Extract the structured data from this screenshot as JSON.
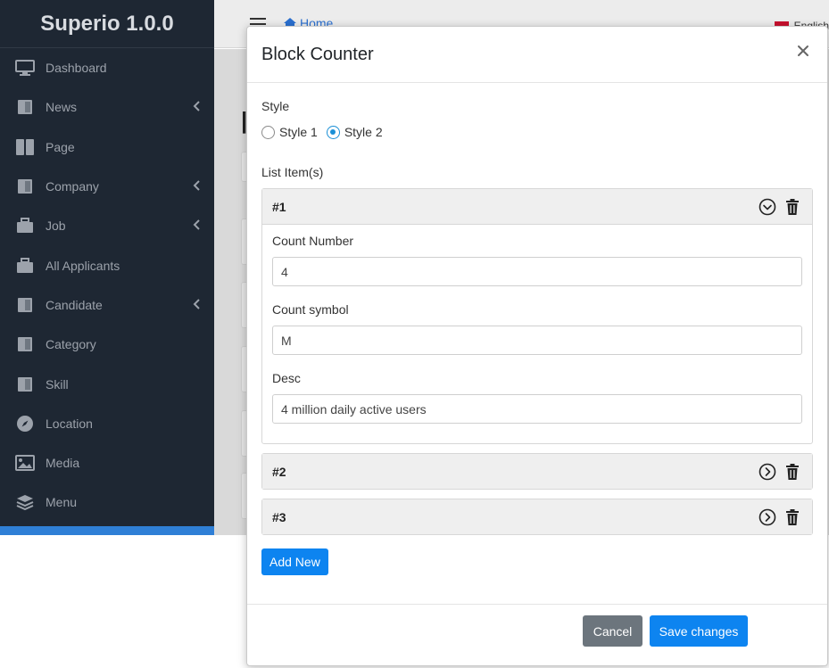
{
  "app": {
    "title": "Superio 1.0.0"
  },
  "sidebar": {
    "items": [
      {
        "label": "Dashboard",
        "icon": "monitor-icon",
        "has_caret": false
      },
      {
        "label": "News",
        "icon": "book-icon",
        "has_caret": true
      },
      {
        "label": "Page",
        "icon": "pages-icon",
        "has_caret": false
      },
      {
        "label": "Company",
        "icon": "book-icon",
        "has_caret": true
      },
      {
        "label": "Job",
        "icon": "briefcase-icon",
        "has_caret": true
      },
      {
        "label": "All Applicants",
        "icon": "briefcase-icon",
        "has_caret": false
      },
      {
        "label": "Candidate",
        "icon": "book-icon",
        "has_caret": true
      },
      {
        "label": "Category",
        "icon": "book-icon",
        "has_caret": false
      },
      {
        "label": "Skill",
        "icon": "book-icon",
        "has_caret": false
      },
      {
        "label": "Location",
        "icon": "compass-icon",
        "has_caret": false
      },
      {
        "label": "Media",
        "icon": "image-icon",
        "has_caret": false
      },
      {
        "label": "Menu",
        "icon": "layers-icon",
        "has_caret": false
      }
    ]
  },
  "topbar": {
    "home_label": "Home",
    "lang_label": "English"
  },
  "modal": {
    "title": "Block Counter",
    "style_label": "Style",
    "style_options": [
      {
        "label": "Style 1",
        "checked": false
      },
      {
        "label": "Style 2",
        "checked": true
      }
    ],
    "list_label": "List Item(s)",
    "items": [
      {
        "title": "#1",
        "expanded": true,
        "count_number_label": "Count Number",
        "count_number_value": "4",
        "count_symbol_label": "Count symbol",
        "count_symbol_value": "M",
        "desc_label": "Desc",
        "desc_value": "4 million daily active users"
      },
      {
        "title": "#2",
        "expanded": false
      },
      {
        "title": "#3",
        "expanded": false
      }
    ],
    "add_new_label": "Add New",
    "cancel_label": "Cancel",
    "save_label": "Save changes"
  },
  "colors": {
    "primary": "#0d84f0",
    "sidebar_bg": "#1e2733",
    "secondary": "#6c757d"
  }
}
